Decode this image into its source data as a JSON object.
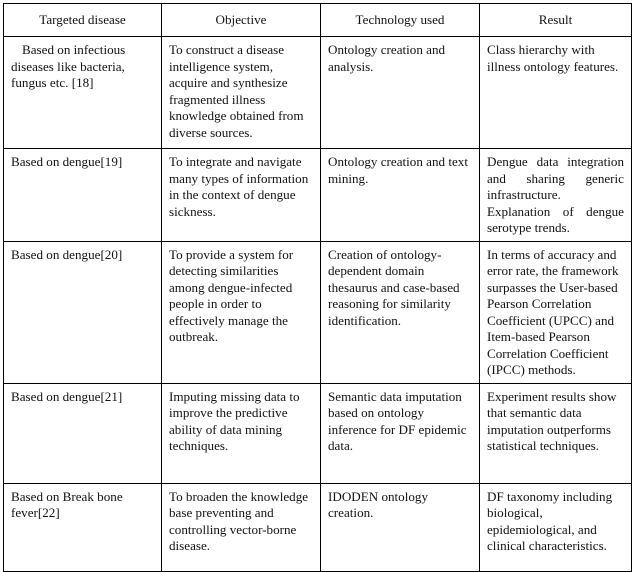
{
  "table": {
    "caption_visible": false,
    "columns": [
      {
        "key": "targeted_disease",
        "label": "Targeted disease",
        "align": "center"
      },
      {
        "key": "objective",
        "label": "Objective",
        "align": "center"
      },
      {
        "key": "technology_used",
        "label": "Technology used",
        "align": "center"
      },
      {
        "key": "result",
        "label": "Result",
        "align": "center"
      }
    ],
    "rows": [
      {
        "targeted_disease": "Based on infectious diseases like bacteria, fungus etc.  [18]",
        "objective": "To construct a disease intelligence system, acquire and synthesize fragmented illness knowledge obtained from diverse sources.",
        "technology_used": "Ontology creation and analysis.",
        "result": "Class hierarchy with illness ontology features.",
        "result_justified": false
      },
      {
        "targeted_disease": "Based on dengue[19]",
        "objective": "To integrate and navigate many types of information in the context of dengue sickness.",
        "technology_used": "Ontology creation and text mining.",
        "result": "Dengue data integration and sharing generic infrastructure. Explanation of dengue serotype trends.",
        "result_justified": true
      },
      {
        "targeted_disease": "Based on dengue[20]",
        "objective": "To provide a system for detecting similarities among dengue-infected people in order to effectively manage the outbreak.",
        "technology_used": "Creation of ontology-dependent domain thesaurus and case-based reasoning for similarity identification.",
        "result": "In terms of accuracy and error rate, the framework surpasses the User-based Pearson Correlation Coefficient (UPCC) and Item-based Pearson Correlation Coefficient (IPCC) methods.",
        "result_justified": false
      },
      {
        "targeted_disease": "Based on dengue[21]",
        "objective": "Imputing missing data to improve the predictive ability of data mining techniques.",
        "technology_used": "Semantic data imputation based on ontology inference for DF epidemic data.",
        "result": "Experiment results show that semantic data imputation outperforms statistical techniques.",
        "result_justified": false
      },
      {
        "targeted_disease": "Based on Break bone fever[22]",
        "objective": "To broaden the knowledge base preventing and controlling vector-borne disease.",
        "technology_used": "IDODEN ontology creation.",
        "result": "DF taxonomy including biological, epidemiological, and clinical characteristics.",
        "result_justified": false
      }
    ]
  },
  "style": {
    "border_color": "#000000",
    "text_color": "#111111",
    "background_color": "#ffffff"
  }
}
